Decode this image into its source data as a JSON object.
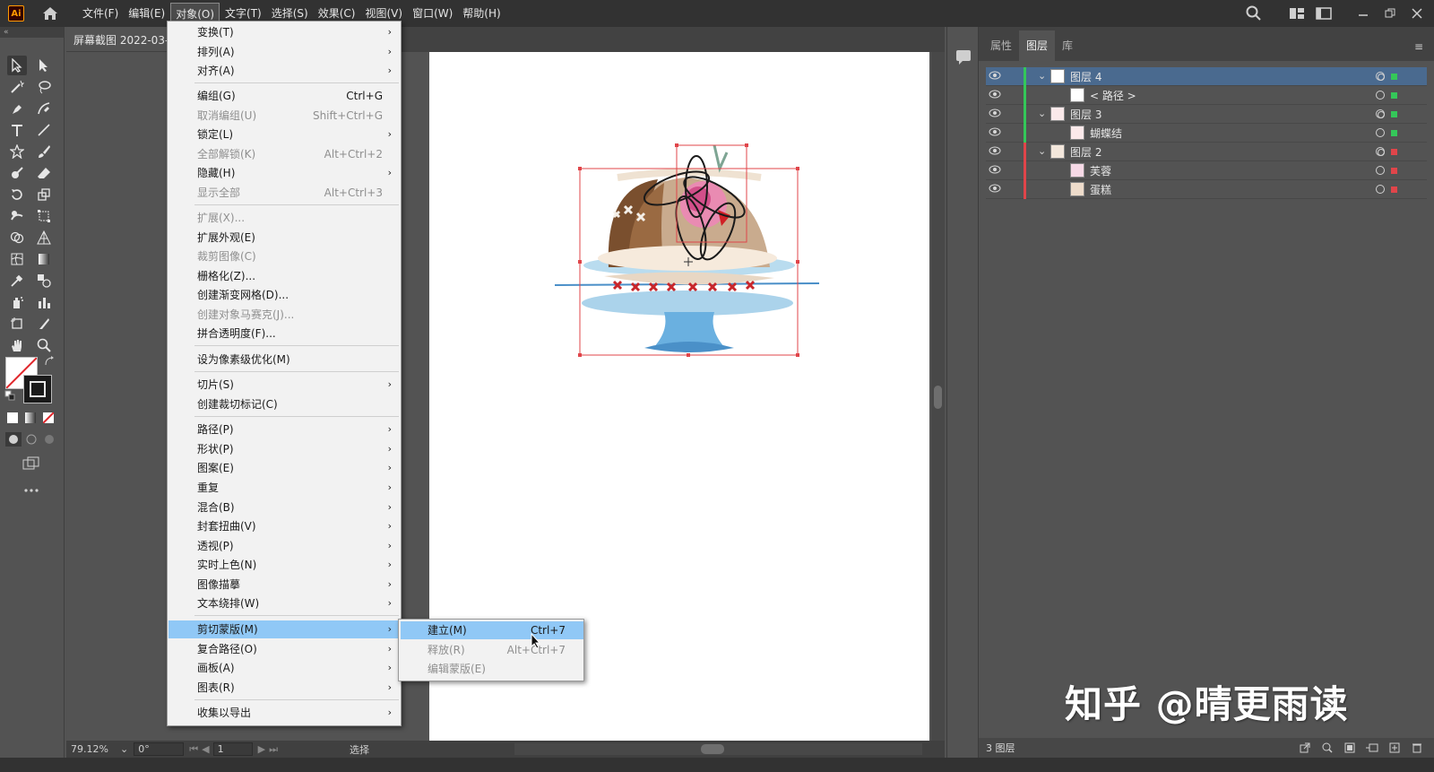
{
  "app": {
    "logo_text": "Ai"
  },
  "menubar": {
    "items": [
      "文件(F)",
      "编辑(E)",
      "对象(O)",
      "文字(T)",
      "选择(S)",
      "效果(C)",
      "视图(V)",
      "窗口(W)",
      "帮助(H)"
    ],
    "active_index": 2
  },
  "document": {
    "tab_title": "屏幕截图 2022-03-"
  },
  "object_menu": {
    "items": [
      {
        "label": "变换(T)",
        "shortcut": "",
        "submenu": true,
        "disabled": false
      },
      {
        "label": "排列(A)",
        "shortcut": "",
        "submenu": true,
        "disabled": false
      },
      {
        "label": "对齐(A)",
        "shortcut": "",
        "submenu": true,
        "disabled": false
      },
      {
        "label": "编组(G)",
        "shortcut": "Ctrl+G",
        "submenu": false,
        "disabled": false
      },
      {
        "label": "取消编组(U)",
        "shortcut": "Shift+Ctrl+G",
        "submenu": false,
        "disabled": true
      },
      {
        "label": "锁定(L)",
        "shortcut": "",
        "submenu": true,
        "disabled": false
      },
      {
        "label": "全部解锁(K)",
        "shortcut": "Alt+Ctrl+2",
        "submenu": false,
        "disabled": true
      },
      {
        "label": "隐藏(H)",
        "shortcut": "",
        "submenu": true,
        "disabled": false
      },
      {
        "label": "显示全部",
        "shortcut": "Alt+Ctrl+3",
        "submenu": false,
        "disabled": true
      },
      {
        "label": "扩展(X)...",
        "shortcut": "",
        "submenu": false,
        "disabled": true
      },
      {
        "label": "扩展外观(E)",
        "shortcut": "",
        "submenu": false,
        "disabled": false
      },
      {
        "label": "裁剪图像(C)",
        "shortcut": "",
        "submenu": false,
        "disabled": true
      },
      {
        "label": "栅格化(Z)...",
        "shortcut": "",
        "submenu": false,
        "disabled": false
      },
      {
        "label": "创建渐变网格(D)...",
        "shortcut": "",
        "submenu": false,
        "disabled": false
      },
      {
        "label": "创建对象马赛克(J)...",
        "shortcut": "",
        "submenu": false,
        "disabled": true
      },
      {
        "label": "拼合透明度(F)...",
        "shortcut": "",
        "submenu": false,
        "disabled": false
      },
      {
        "label": "设为像素级优化(M)",
        "shortcut": "",
        "submenu": false,
        "disabled": false
      },
      {
        "label": "切片(S)",
        "shortcut": "",
        "submenu": true,
        "disabled": false
      },
      {
        "label": "创建裁切标记(C)",
        "shortcut": "",
        "submenu": false,
        "disabled": false
      },
      {
        "label": "路径(P)",
        "shortcut": "",
        "submenu": true,
        "disabled": false
      },
      {
        "label": "形状(P)",
        "shortcut": "",
        "submenu": true,
        "disabled": false
      },
      {
        "label": "图案(E)",
        "shortcut": "",
        "submenu": true,
        "disabled": false
      },
      {
        "label": "重复",
        "shortcut": "",
        "submenu": true,
        "disabled": false
      },
      {
        "label": "混合(B)",
        "shortcut": "",
        "submenu": true,
        "disabled": false
      },
      {
        "label": "封套扭曲(V)",
        "shortcut": "",
        "submenu": true,
        "disabled": false
      },
      {
        "label": "透视(P)",
        "shortcut": "",
        "submenu": true,
        "disabled": false
      },
      {
        "label": "实时上色(N)",
        "shortcut": "",
        "submenu": true,
        "disabled": false
      },
      {
        "label": "图像描摹",
        "shortcut": "",
        "submenu": true,
        "disabled": false
      },
      {
        "label": "文本绕排(W)",
        "shortcut": "",
        "submenu": true,
        "disabled": false
      },
      {
        "label": "剪切蒙版(M)",
        "shortcut": "",
        "submenu": true,
        "disabled": false
      },
      {
        "label": "复合路径(O)",
        "shortcut": "",
        "submenu": true,
        "disabled": false
      },
      {
        "label": "画板(A)",
        "shortcut": "",
        "submenu": true,
        "disabled": false
      },
      {
        "label": "图表(R)",
        "shortcut": "",
        "submenu": true,
        "disabled": false
      },
      {
        "label": "收集以导出",
        "shortcut": "",
        "submenu": true,
        "disabled": false
      }
    ],
    "highlighted_index": 29
  },
  "clipping_mask_submenu": {
    "items": [
      {
        "label": "建立(M)",
        "shortcut": "Ctrl+7",
        "disabled": false
      },
      {
        "label": "释放(R)",
        "shortcut": "Alt+Ctrl+7",
        "disabled": true
      },
      {
        "label": "编辑蒙版(E)",
        "shortcut": "",
        "disabled": true
      }
    ],
    "highlighted_index": 0
  },
  "right_panel": {
    "tabs": [
      "属性",
      "图层",
      "库"
    ],
    "active_tab": 1,
    "layers": [
      {
        "name": "图层 4",
        "level": 0,
        "color": "#34c759"
      },
      {
        "name": "< 路径 >",
        "level": 1,
        "color": "#34c759"
      },
      {
        "name": "图层 3",
        "level": 0,
        "color": "#34c759"
      },
      {
        "name": "蝴蝶结",
        "level": 1,
        "color": "#34c759"
      },
      {
        "name": "图层 2",
        "level": 0,
        "color": "#e0454a"
      },
      {
        "name": "芙蓉",
        "level": 1,
        "color": "#e0454a"
      },
      {
        "name": "蛋糕",
        "level": 1,
        "color": "#e0454a"
      }
    ],
    "footer_count": "3 图层"
  },
  "statusbar": {
    "zoom": "79.12%",
    "rotation": "0°",
    "artboard": "1",
    "tool": "选择"
  },
  "watermark": "知乎 @晴更雨读",
  "colors": {
    "menubar_bg": "#323232",
    "workspace_bg": "#535353",
    "menu_bg": "#f2f2f2",
    "menu_highlight": "#90c8f6",
    "layer_highlight": "#4a6a8f",
    "selection_box": "#e0454a"
  }
}
